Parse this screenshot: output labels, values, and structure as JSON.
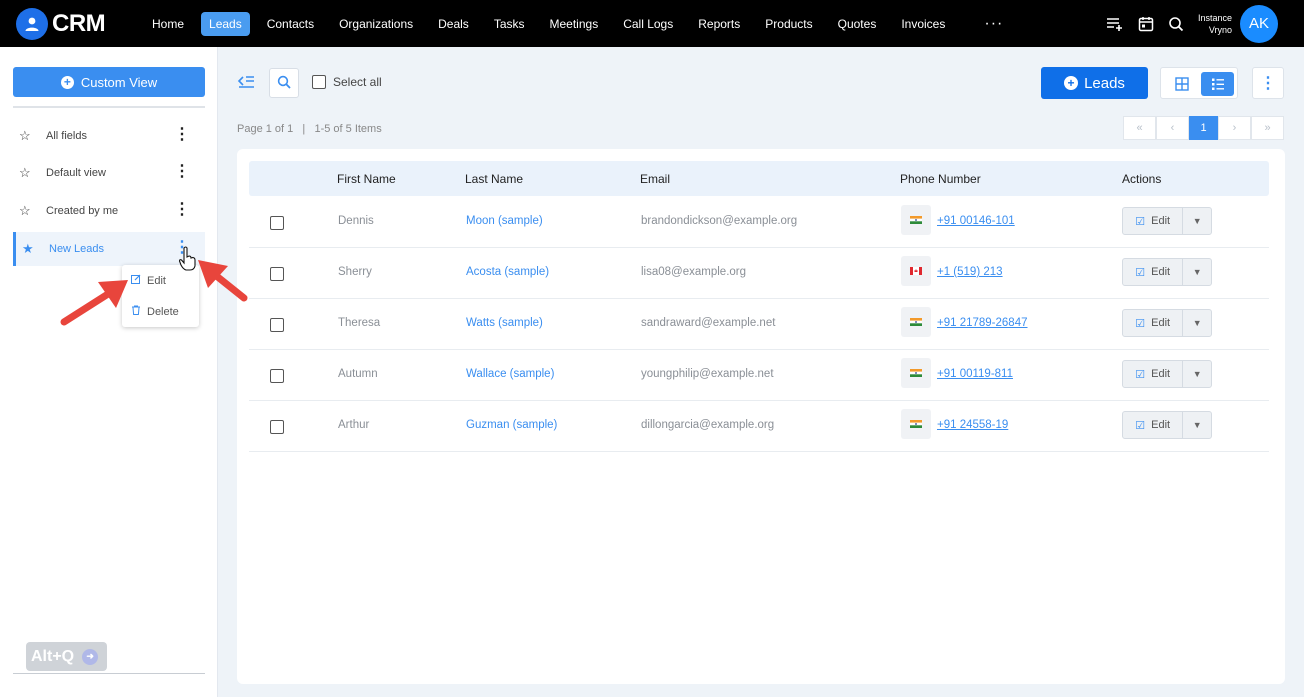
{
  "app": {
    "name": "CRM"
  },
  "nav": {
    "items": [
      "Home",
      "Leads",
      "Contacts",
      "Organizations",
      "Deals",
      "Tasks",
      "Meetings",
      "Call Logs",
      "Reports",
      "Products",
      "Quotes",
      "Invoices"
    ],
    "active": "Leads",
    "more": "···"
  },
  "user": {
    "instance_line1": "Instance",
    "instance_line2": "Vryno",
    "initials": "AK"
  },
  "sidebar": {
    "custom_view_label": "Custom View",
    "views": [
      {
        "label": "All fields"
      },
      {
        "label": "Default view"
      },
      {
        "label": "Created by me"
      },
      {
        "label": "New Leads"
      }
    ],
    "menu": {
      "edit": "Edit",
      "delete": "Delete"
    },
    "shortcut": "Alt+Q"
  },
  "toolbar": {
    "select_all": "Select all",
    "leads_button": "Leads",
    "page_info": "Page 1 of 1   |   1-5 of 5 Items",
    "current_page": "1"
  },
  "table": {
    "headers": [
      "First Name",
      "Last Name",
      "Email",
      "Phone Number",
      "Actions"
    ],
    "rows": [
      {
        "first": "Dennis",
        "last": "Moon (sample)",
        "email": "brandondickson@example.org",
        "phone": "+91 00146-101",
        "country": "india"
      },
      {
        "first": "Sherry",
        "last": "Acosta (sample)",
        "email": "lisa08@example.org",
        "phone": "+1 (519) 213",
        "country": "canada"
      },
      {
        "first": "Theresa",
        "last": "Watts (sample)",
        "email": "sandraward@example.net",
        "phone": "+91 21789-26847",
        "country": "india"
      },
      {
        "first": "Autumn",
        "last": "Wallace (sample)",
        "email": "youngphilip@example.net",
        "phone": "+91 00119-811",
        "country": "india"
      },
      {
        "first": "Arthur",
        "last": "Guzman (sample)",
        "email": "dillongarcia@example.org",
        "phone": "+91 24558-19",
        "country": "india"
      }
    ],
    "edit_label": "Edit"
  },
  "colors": {
    "accent": "#3a8ef0",
    "primary_button": "#0f6fe8",
    "annotation_arrow": "#e8453c"
  }
}
